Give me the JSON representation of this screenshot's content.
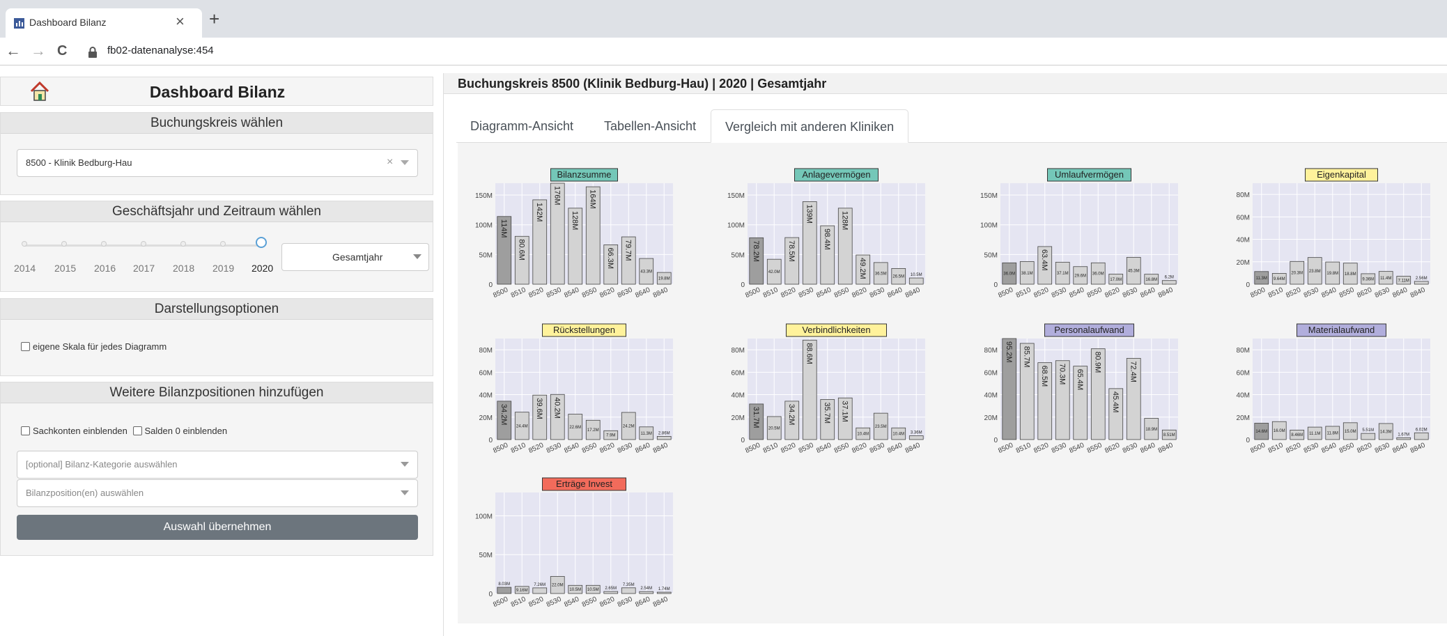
{
  "browser": {
    "tab_title": "Dashboard Bilanz",
    "url": "fb02-datenanalyse:454",
    "close_glyph": "×",
    "newtab_glyph": "+",
    "back_glyph": "←",
    "forward_glyph": "→",
    "reload_glyph": "C"
  },
  "sidebar": {
    "title": "Dashboard Bilanz",
    "bk": {
      "header": "Buchungskreis wählen",
      "value": "8500 - Klinik Bedburg-Hau",
      "clear_glyph": "×"
    },
    "gj": {
      "header": "Geschäftsjahr und Zeitraum wählen",
      "years": [
        "2014",
        "2015",
        "2016",
        "2017",
        "2018",
        "2019",
        "2020"
      ],
      "selected_year": "2020",
      "period": "Gesamtjahr"
    },
    "darst": {
      "header": "Darstellungsoptionen",
      "own_scale_label": "eigene Skala für jedes Diagramm"
    },
    "wb": {
      "header": "Weitere Bilanzpositionen hinzufügen",
      "sachkonten_label": "Sachkonten einblenden",
      "salden_label": "Salden 0 einblenden",
      "kategorie_placeholder": "[optional] Bilanz-Kategorie auswählen",
      "position_placeholder": "Bilanzposition(en) auswählen",
      "apply_label": "Auswahl übernehmen"
    }
  },
  "main": {
    "title": "Buchungskreis 8500 (Klinik Bedburg-Hau) | 2020 | Gesamtjahr",
    "tabs": [
      "Diagramm-Ansicht",
      "Tabellen-Ansicht",
      "Vergleich mit anderen Kliniken"
    ],
    "active_tab": 2
  },
  "colors": {
    "highlight_bar": "#9e9e9e",
    "bar": "#d3d3d3",
    "plot_bg": "#e5e5f2",
    "grid": "#ffffff"
  },
  "chart_data": [
    {
      "type": "bar",
      "title": "Bilanzsumme",
      "title_bg": "#74c7b8",
      "categories": [
        "8500",
        "8510",
        "8520",
        "8530",
        "8540",
        "8550",
        "8620",
        "8630",
        "8640",
        "8840"
      ],
      "values": [
        114,
        80.6,
        142,
        176,
        128,
        164,
        66.3,
        79.7,
        43.3,
        19.8
      ],
      "labels": [
        "114M",
        "80.6M",
        "142M",
        "176M",
        "128M",
        "164M",
        "66.3M",
        "79.7M",
        "43.3M",
        "19.8M"
      ],
      "ylim": [
        0,
        170
      ],
      "yticks": [
        0,
        50,
        100,
        150
      ],
      "yticklabels": [
        "0",
        "50M",
        "100M",
        "150M"
      ]
    },
    {
      "type": "bar",
      "title": "Anlagevermögen",
      "title_bg": "#74c7b8",
      "categories": [
        "8500",
        "8510",
        "8520",
        "8530",
        "8540",
        "8550",
        "8620",
        "8630",
        "8640",
        "8840"
      ],
      "values": [
        78.2,
        42.0,
        78.5,
        139,
        98.4,
        128,
        49.2,
        36.5,
        26.5,
        10.5
      ],
      "labels": [
        "78.2M",
        "42.0M",
        "78.5M",
        "139M",
        "98.4M",
        "128M",
        "49.2M",
        "36.5M",
        "26.5M",
        "10.5M"
      ],
      "ylim": [
        0,
        170
      ],
      "yticks": [
        0,
        50,
        100,
        150
      ],
      "yticklabels": [
        "0",
        "50M",
        "100M",
        "150M"
      ]
    },
    {
      "type": "bar",
      "title": "Umlaufvermögen",
      "title_bg": "#74c7b8",
      "categories": [
        "8500",
        "8510",
        "8520",
        "8530",
        "8540",
        "8550",
        "8620",
        "8630",
        "8640",
        "8840"
      ],
      "values": [
        36.0,
        38.1,
        63.4,
        37.1,
        29.6,
        36.0,
        17.0,
        45.3,
        16.8,
        6.2
      ],
      "labels": [
        "36.0M",
        "38.1M",
        "63.4M",
        "37.1M",
        "29.6M",
        "36.0M",
        "17.0M",
        "45.3M",
        "16.8M",
        "6.2M"
      ],
      "ylim": [
        0,
        170
      ],
      "yticks": [
        0,
        50,
        100,
        150
      ],
      "yticklabels": [
        "0",
        "50M",
        "100M",
        "150M"
      ]
    },
    {
      "type": "bar",
      "title": "Eigenkapital",
      "title_bg": "#fff29b",
      "categories": [
        "8500",
        "8510",
        "8520",
        "8530",
        "8540",
        "8550",
        "8620",
        "8630",
        "8640",
        "8840"
      ],
      "values": [
        11.3,
        9.64,
        20.3,
        23.8,
        19.8,
        18.8,
        9.36,
        11.4,
        7.11,
        2.56
      ],
      "labels": [
        "11.3M",
        "9.64M",
        "20.3M",
        "23.8M",
        "19.8M",
        "18.8M",
        "9.36M",
        "11.4M",
        "7.11M",
        "2.56M"
      ],
      "ylim": [
        0,
        90
      ],
      "yticks": [
        0,
        20,
        40,
        60,
        80
      ],
      "yticklabels": [
        "0",
        "20M",
        "40M",
        "60M",
        "80M"
      ]
    },
    {
      "type": "bar",
      "title": "Rückstellungen",
      "title_bg": "#fff29b",
      "categories": [
        "8500",
        "8510",
        "8520",
        "8530",
        "8540",
        "8550",
        "8620",
        "8630",
        "8640",
        "8840"
      ],
      "values": [
        34.2,
        24.4,
        39.6,
        40.2,
        22.6,
        17.2,
        7.9,
        24.2,
        11.3,
        2.86
      ],
      "labels": [
        "34.2M",
        "24.4M",
        "39.6M",
        "40.2M",
        "22.6M",
        "17.2M",
        "7.9M",
        "24.2M",
        "11.3M",
        "2.86M"
      ],
      "ylim": [
        0,
        90
      ],
      "yticks": [
        0,
        20,
        40,
        60,
        80
      ],
      "yticklabels": [
        "0",
        "20M",
        "40M",
        "60M",
        "80M"
      ]
    },
    {
      "type": "bar",
      "title": "Verbindlichkeiten",
      "title_bg": "#fff29b",
      "categories": [
        "8500",
        "8510",
        "8520",
        "8530",
        "8540",
        "8550",
        "8620",
        "8630",
        "8640",
        "8840"
      ],
      "values": [
        31.7,
        20.5,
        34.2,
        88.6,
        35.7,
        37.1,
        10.4,
        23.5,
        10.4,
        3.36
      ],
      "labels": [
        "31.7M",
        "20.5M",
        "34.2M",
        "88.6M",
        "35.7M",
        "37.1M",
        "10.4M",
        "23.5M",
        "10.4M",
        "3.36M"
      ],
      "ylim": [
        0,
        90
      ],
      "yticks": [
        0,
        20,
        40,
        60,
        80
      ],
      "yticklabels": [
        "0",
        "20M",
        "40M",
        "60M",
        "80M"
      ]
    },
    {
      "type": "bar",
      "title": "Personalaufwand",
      "title_bg": "#b1aedc",
      "categories": [
        "8500",
        "8510",
        "8520",
        "8530",
        "8540",
        "8550",
        "8620",
        "8630",
        "8640",
        "8840"
      ],
      "values": [
        95.2,
        85.7,
        68.5,
        70.3,
        65.4,
        80.9,
        45.4,
        72.4,
        18.9,
        8.51
      ],
      "labels": [
        "95.2M",
        "85.7M",
        "68.5M",
        "70.3M",
        "65.4M",
        "80.9M",
        "45.4M",
        "72.4M",
        "18.9M",
        "8.51M"
      ],
      "ylim": [
        0,
        90
      ],
      "yticks": [
        0,
        20,
        40,
        60,
        80
      ],
      "yticklabels": [
        "0",
        "20M",
        "40M",
        "60M",
        "80M"
      ]
    },
    {
      "type": "bar",
      "title": "Materialaufwand",
      "title_bg": "#b1aedc",
      "categories": [
        "8500",
        "8510",
        "8520",
        "8530",
        "8540",
        "8550",
        "8620",
        "8630",
        "8640",
        "8840"
      ],
      "values": [
        14.6,
        16.0,
        8.46,
        11.1,
        11.8,
        15.0,
        5.51,
        14.3,
        1.67,
        6.02
      ],
      "labels": [
        "14.6M",
        "16.0M",
        "8.46M",
        "11.1M",
        "11.8M",
        "15.0M",
        "5.51M",
        "14.3M",
        "1.67M",
        "6.02M"
      ],
      "ylim": [
        0,
        90
      ],
      "yticks": [
        0,
        20,
        40,
        60,
        80
      ],
      "yticklabels": [
        "0",
        "20M",
        "40M",
        "60M",
        "80M"
      ]
    },
    {
      "type": "bar",
      "title": "Erträge Invest",
      "title_bg": "#f26b5b",
      "categories": [
        "8500",
        "8510",
        "8520",
        "8530",
        "8540",
        "8550",
        "8620",
        "8630",
        "8640",
        "8840"
      ],
      "values": [
        8.03,
        9.16,
        7.26,
        22.0,
        10.5,
        10.5,
        2.65,
        7.35,
        2.54,
        1.74
      ],
      "labels": [
        "8.03M",
        "9.16M",
        "7.26M",
        "22.0M",
        "10.5M",
        "10.5M",
        "2.65M",
        "7.35M",
        "2.54M",
        "1.74M"
      ],
      "ylim": [
        0,
        130
      ],
      "yticks": [
        0,
        50,
        100
      ],
      "yticklabels": [
        "0",
        "50M",
        "100M"
      ]
    }
  ]
}
